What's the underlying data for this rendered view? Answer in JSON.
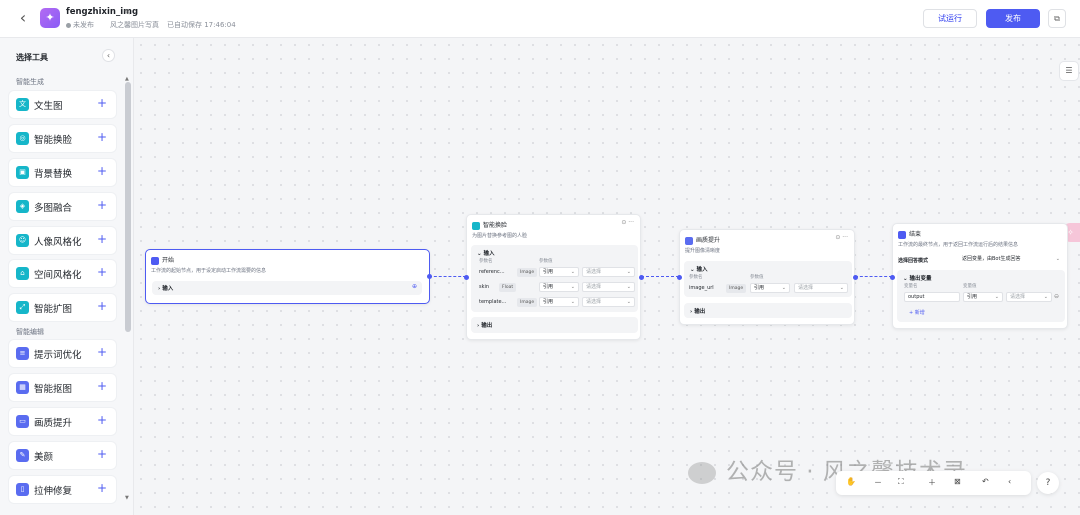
{
  "header": {
    "app_name": "fengzhixin_img",
    "status": "未发布",
    "description": "风之馨图片写真",
    "save_time": "已自动保存 17:46:04",
    "test_run_label": "试运行",
    "publish_label": "发布"
  },
  "sidebar": {
    "title": "选择工具",
    "section_generate": "智能生成",
    "section_edit": "智能编辑",
    "generate_items": [
      {
        "label": "文生图",
        "icon": "文"
      },
      {
        "label": "智能换脸",
        "icon": "face-icon"
      },
      {
        "label": "背景替换",
        "icon": "background-icon"
      },
      {
        "label": "多图融合",
        "icon": "merge-icon"
      },
      {
        "label": "人像风格化",
        "icon": "portrait-icon"
      },
      {
        "label": "空间风格化",
        "icon": "space-icon"
      },
      {
        "label": "智能扩图",
        "icon": "expand-icon"
      }
    ],
    "edit_items": [
      {
        "label": "提示词优化",
        "icon": "prompt-icon"
      },
      {
        "label": "智能抠图",
        "icon": "cutout-icon"
      },
      {
        "label": "画质提升",
        "icon": "quality-icon"
      },
      {
        "label": "美颜",
        "icon": "beauty-icon"
      },
      {
        "label": "拉伸修复",
        "icon": "stretch-icon"
      }
    ]
  },
  "nodes": {
    "start": {
      "title": "开始",
      "desc": "工作流的起始节点，用于设定启动工作流需要的信息",
      "input_label": "输入"
    },
    "faceswap": {
      "title": "智能换脸",
      "desc": "为图片替换参考图的人脸",
      "input_label": "输入",
      "col_name": "参数名",
      "col_value": "参数值",
      "params": [
        {
          "name": "referenc...",
          "type": "Image",
          "mode": "引用",
          "value": "请选择"
        },
        {
          "name": "skin",
          "type": "Float",
          "mode": "引用",
          "value": "请选择"
        },
        {
          "name": "template...",
          "type": "Image",
          "mode": "引用",
          "value": "请选择"
        }
      ],
      "output_label": "输出"
    },
    "quality": {
      "title": "画质提升",
      "desc": "提升图像清晰度",
      "input_label": "输入",
      "col_name": "参数名",
      "col_value": "参数值",
      "params": [
        {
          "name": "image_url",
          "type": "Image",
          "mode": "引用",
          "value": "请选择"
        }
      ],
      "output_label": "输出"
    },
    "end": {
      "title": "结束",
      "desc": "工作流的最终节点，用于返回工作流运行后的结果信息",
      "answer_mode_label": "选择回答模式",
      "answer_mode_value": "返回变量，由Bot生成回答",
      "output_var_label": "输出变量",
      "col_name": "变量名",
      "col_value": "变量值",
      "var_name": "output",
      "var_mode": "引用",
      "var_value": "请选择",
      "add_label": "新增"
    }
  },
  "watermark": "公众号 · 风之馨技术录"
}
